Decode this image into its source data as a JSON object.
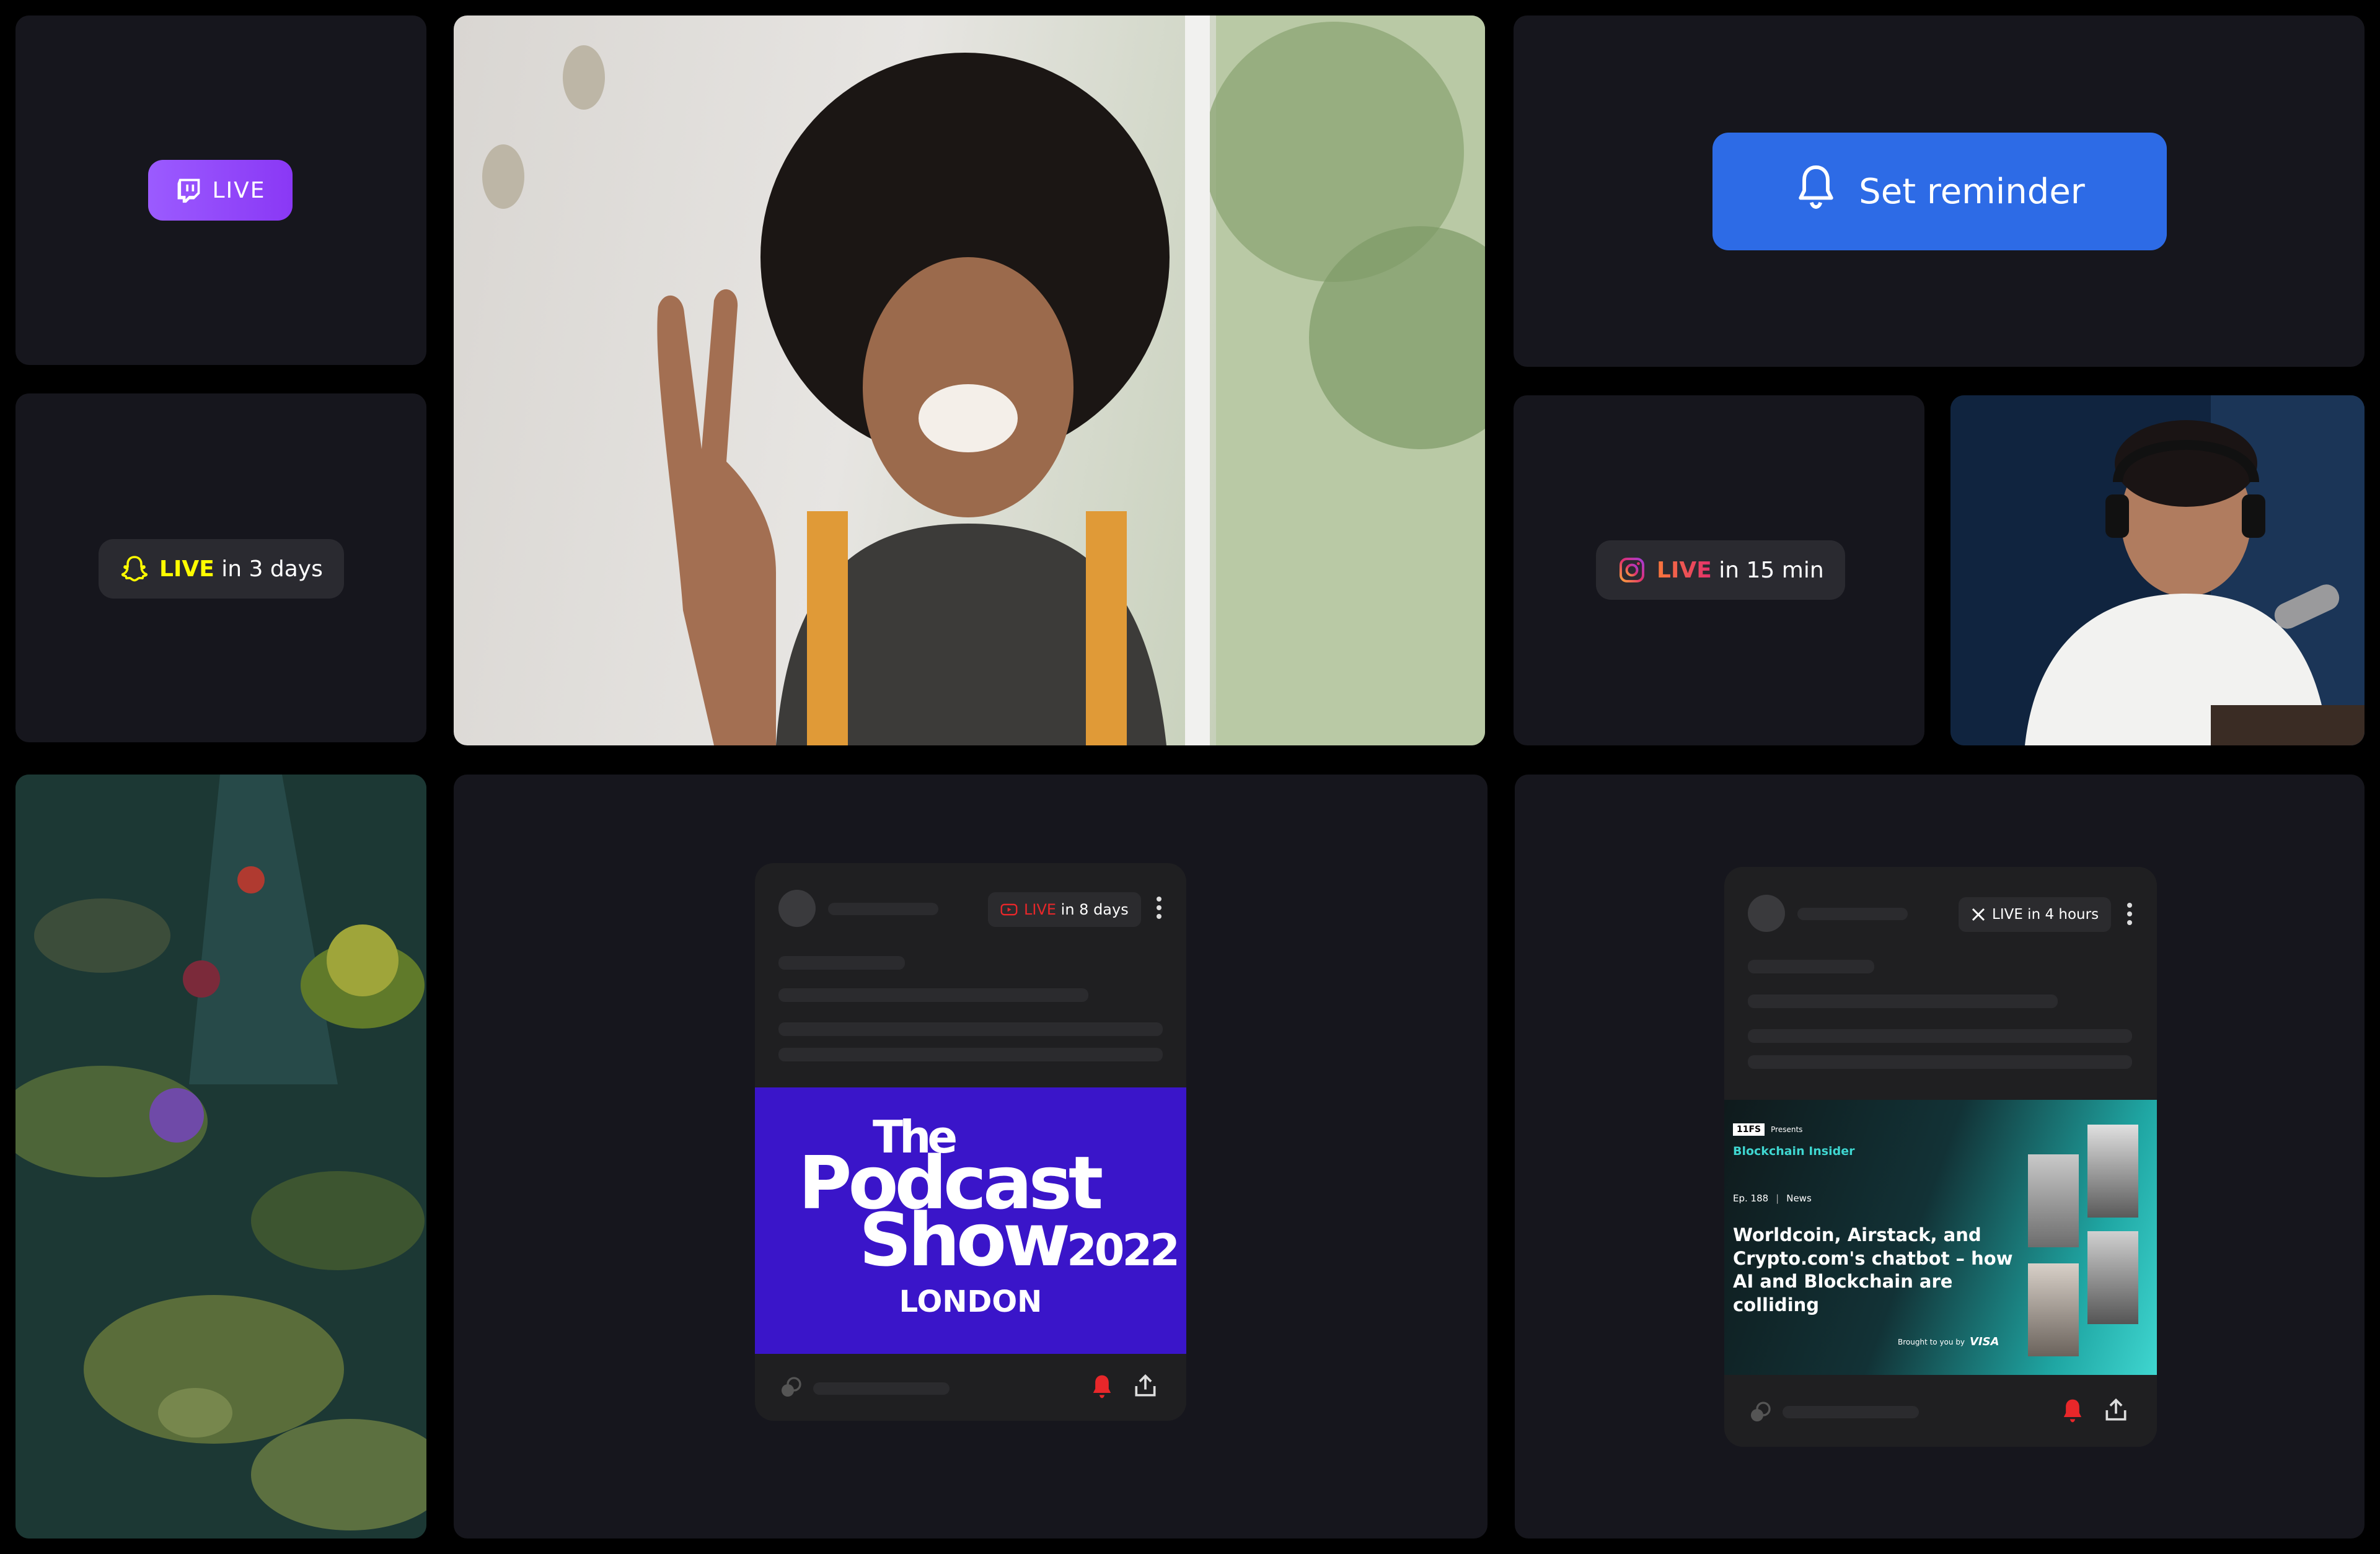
{
  "badges": {
    "twitch": {
      "label": "LIVE",
      "color": "#9147ff"
    },
    "snapchat": {
      "live": "LIVE",
      "suffix": " in 3 days",
      "live_color": "#fffc00"
    },
    "instagram": {
      "live": "LIVE",
      "suffix": " in 15 min"
    }
  },
  "reminder": {
    "label": "Set reminder",
    "color": "#2d6be6",
    "icon": "bell-icon"
  },
  "podcast_card": {
    "badge_live": "LIVE",
    "badge_suffix": " in 8 days",
    "poster": {
      "line1": "The",
      "line2": "Podcast",
      "line3": "Show",
      "year": "2022",
      "city": "LONDON",
      "color": "#3a15c9"
    }
  },
  "x_card": {
    "badge_label": "LIVE in 4 hours",
    "poster": {
      "brand": "11FS",
      "presents": "Presents",
      "show": "Blockchain Insider",
      "episode": "Ep. 188",
      "category": "News",
      "headline": "Worldcoin, Airstack, and Crypto.com's chatbot – how AI and Blockchain are colliding",
      "sponsor_prefix": "Brought to you by",
      "sponsor": "VISA"
    }
  },
  "colors": {
    "alert_red": "#e8272a",
    "tile_bg": "#16161d",
    "accent_blue": "#2d6be6"
  }
}
